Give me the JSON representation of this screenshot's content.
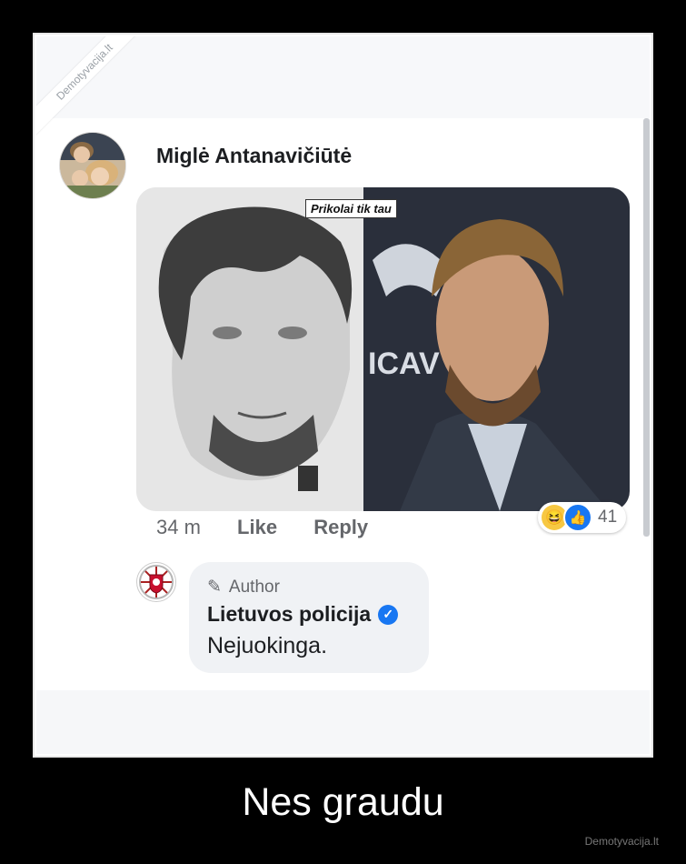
{
  "watermark": "Demotyvacija.lt",
  "post": {
    "author_name": "Miglė Antanavičiūtė",
    "meme_caption": "Prikolai tik tau",
    "meta": {
      "time": "34 m",
      "like_label": "Like",
      "reply_label": "Reply"
    },
    "reactions": {
      "count": "41",
      "icons": [
        "haha-icon",
        "like-icon"
      ]
    }
  },
  "reply": {
    "badge": "Author",
    "author_name": "Lietuvos policija",
    "text": "Nejuokinga."
  },
  "caption": "Nes graudu",
  "footer": "Demotyvacija.lt",
  "colors": {
    "accent": "#1877f2",
    "background": "#000000",
    "bubble": "#f0f2f5"
  }
}
